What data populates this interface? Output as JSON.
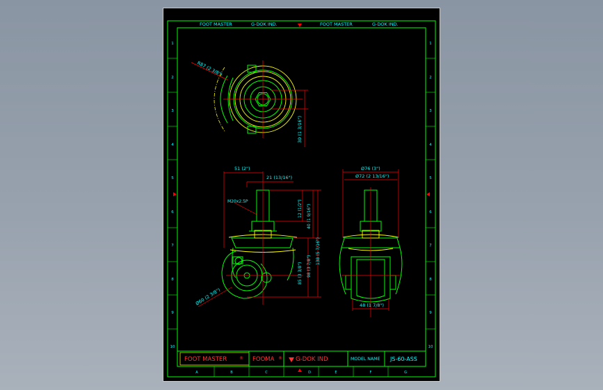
{
  "header": {
    "brand_1": "FOOT MASTER",
    "company_1": "G-DOK IND.",
    "brand_2": "FOOT MASTER",
    "company_2": "G-DOK IND."
  },
  "row_numbers": [
    "1",
    "2",
    "3",
    "4",
    "5",
    "6",
    "7",
    "8",
    "9",
    "10"
  ],
  "col_letters": [
    "A",
    "B",
    "C",
    "D",
    "E",
    "F",
    "G"
  ],
  "dimensions": {
    "top_radius": "R87 (2 3/8\")",
    "top_height": "30 (1 3/16\")",
    "offset_total": "51 (2\")",
    "offset_inner": "21 (13/16\")",
    "thread": "M20x2.5P",
    "stem": "12 (1/2\")",
    "stem_total": "40 (1 9/16\")",
    "height_wheel": "85 (3 3/8\")",
    "height_body": "98 (3 7/8\")",
    "height_total": "138 (5 7/16\")",
    "wheel_dia": "Ø60 (2 3/8\")",
    "width_outer": "Ø76 (3\")",
    "width_inner": "Ø72 (2 13/16\")",
    "wheel_width": "48 (1 7/8\")"
  },
  "title_block": {
    "brand": "FOOT MASTER",
    "brand2": "FOOMA",
    "company": "G-DOK IND",
    "model_label": "MODEL NAME",
    "model_value": "JS-60-ASS"
  },
  "colors": {
    "border": "#00ff00",
    "line": "#ffff00",
    "dim": "#ff0000",
    "text": "#00ffff",
    "red_text": "#ff3333",
    "marker": "#ff0000"
  }
}
